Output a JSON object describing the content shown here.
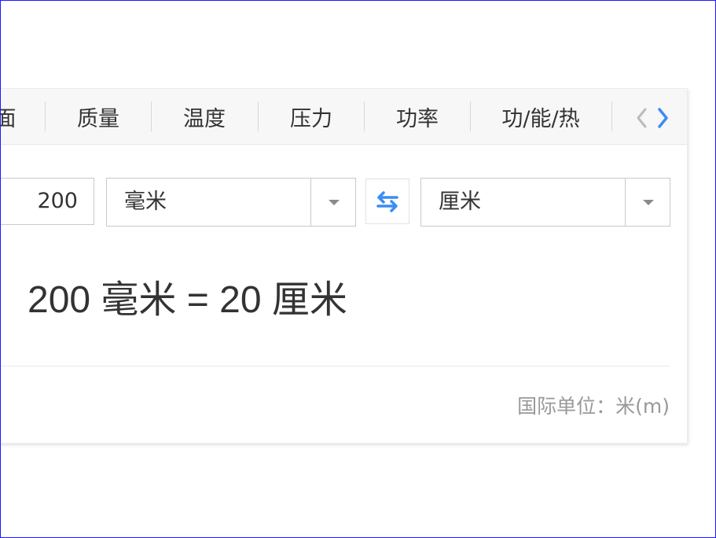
{
  "tabs": [
    {
      "label": "面积"
    },
    {
      "label": "质量"
    },
    {
      "label": "温度"
    },
    {
      "label": "压力"
    },
    {
      "label": "功率"
    },
    {
      "label": "功/能/热"
    }
  ],
  "converter": {
    "amount": "200",
    "from_unit": "毫米",
    "to_unit": "厘米"
  },
  "result": {
    "text": "200 毫米 = 20 厘米"
  },
  "footer": {
    "si_unit": "国际单位：米(m)"
  },
  "colors": {
    "accent": "#3b8cf5",
    "arrow_disabled": "#bbbbbb"
  },
  "icons": {
    "prev": "chevron-left-icon",
    "next": "chevron-right-icon",
    "swap": "swap-arrows-icon",
    "dropdown": "caret-down-icon"
  }
}
